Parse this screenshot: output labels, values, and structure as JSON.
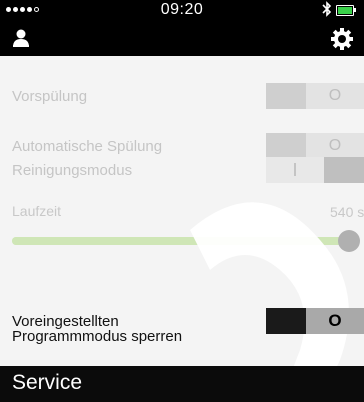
{
  "status_bar": {
    "time": "09:20",
    "bluetooth_icon": "bluetooth-icon",
    "battery_color": "#3ad14a"
  },
  "top_bar": {
    "left_icon": "user-icon",
    "right_icon": "gear-icon"
  },
  "settings": [
    {
      "label": "Vorspülung",
      "state": "off",
      "toggle_text": "O"
    },
    {
      "label": "Automatische Spülung",
      "state": "off",
      "toggle_text": "O"
    },
    {
      "label": "Reinigungsmodus",
      "state": "on",
      "toggle_text": "I"
    }
  ],
  "runtime": {
    "label": "Laufzeit",
    "value": "540 s",
    "slider_fraction": 1.0
  },
  "lock": {
    "label_line1": "Voreingestellten",
    "label_line2": "Programmmodus sperren",
    "toggle_text": "O"
  },
  "service": {
    "label": "Service"
  },
  "colors": {
    "accent_green": "#cfe6b6",
    "watermark": "#ffffff"
  }
}
